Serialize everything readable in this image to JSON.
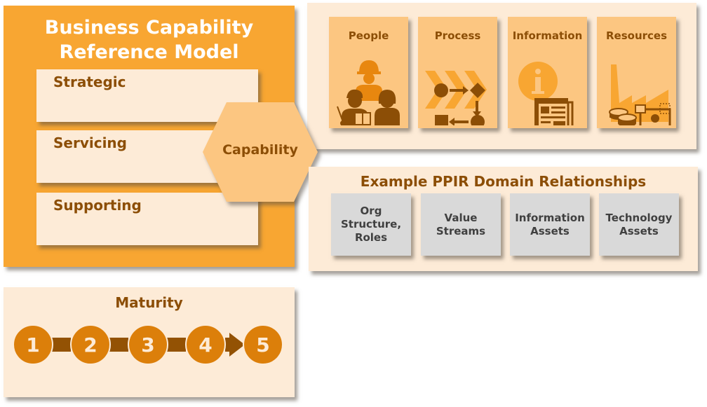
{
  "reference_model": {
    "title_line1": "Business Capability",
    "title_line2": "Reference Model",
    "tiers": [
      {
        "label": "Strategic"
      },
      {
        "label": "Servicing"
      },
      {
        "label": "Supporting"
      }
    ]
  },
  "capability": {
    "label": "Capability"
  },
  "ppir_domains": [
    {
      "label": "People",
      "icon": "people-group-icon"
    },
    {
      "label": "Process",
      "icon": "process-flow-icon"
    },
    {
      "label": "Information",
      "icon": "information-newspaper-icon"
    },
    {
      "label": "Resources",
      "icon": "factory-resources-icon"
    }
  ],
  "relationships": {
    "title": "Example PPIR Domain Relationships",
    "items": [
      {
        "label": "Org\nStructure,\nRoles"
      },
      {
        "label": "Value\nStreams"
      },
      {
        "label": "Information\nAssets"
      },
      {
        "label": "Technology\nAssets"
      }
    ]
  },
  "maturity": {
    "title": "Maturity",
    "levels": [
      "1",
      "2",
      "3",
      "4",
      "5"
    ]
  },
  "colors": {
    "orange": "#f8a632",
    "light_orange": "#fcc681",
    "cream": "#fdebd7",
    "brown": "#8c4e06",
    "dark_brown": "#935204",
    "circle_orange": "#dc7f0a",
    "gray": "#d9d9d9"
  }
}
